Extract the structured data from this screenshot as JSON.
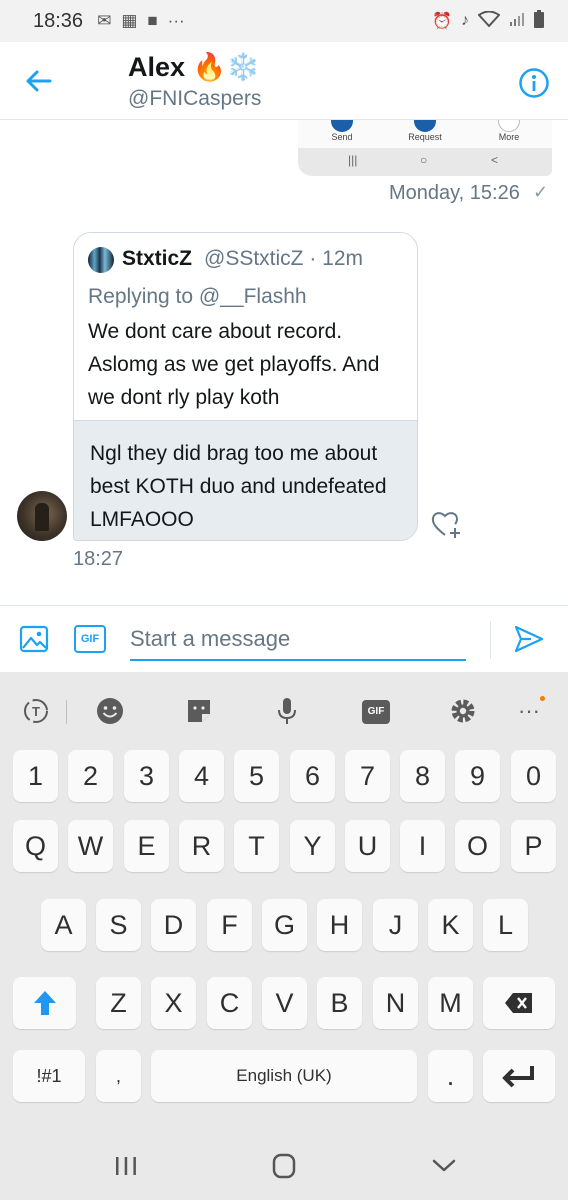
{
  "status_bar": {
    "time": "18:36",
    "more": "···"
  },
  "header": {
    "name": "Alex 🔥❄️",
    "handle": "@FNICaspers"
  },
  "sent_message": {
    "image_buttons": [
      "Send",
      "Request",
      "More"
    ],
    "timestamp": "Monday, 15:26",
    "status": "✓"
  },
  "received_message": {
    "quoted_tweet": {
      "author_name": "StxticZ",
      "author_handle": "@SStxticZ · 12m",
      "replying_to": "Replying to @__Flashh",
      "text": "We dont care about record. Aslomg as we get playoffs. And we dont rly play koth"
    },
    "text": "Ngl they did brag too me about best KOTH duo and undefeated LMFAOOO",
    "timestamp": "18:27"
  },
  "composer": {
    "placeholder": "Start a message",
    "gif_label": "GIF"
  },
  "keyboard": {
    "toolbar_gif_label": "GIF",
    "toolbar_more": "···",
    "row_numbers": [
      "1",
      "2",
      "3",
      "4",
      "5",
      "6",
      "7",
      "8",
      "9",
      "0"
    ],
    "row_qwerty": [
      "Q",
      "W",
      "E",
      "R",
      "T",
      "Y",
      "U",
      "I",
      "O",
      "P"
    ],
    "row_asdf": [
      "A",
      "S",
      "D",
      "F",
      "G",
      "H",
      "J",
      "K",
      "L"
    ],
    "row_zxcv": [
      "Z",
      "X",
      "C",
      "V",
      "B",
      "N",
      "M"
    ],
    "symbols_label": "!#1",
    "comma_label": ",",
    "space_label": "English (UK)",
    "period_label": "."
  },
  "colors": {
    "accent": "#1da1f2",
    "secondary_text": "#657786",
    "bubble_bg": "#e6ecf0",
    "keyboard_bg": "#e9e9e9"
  }
}
